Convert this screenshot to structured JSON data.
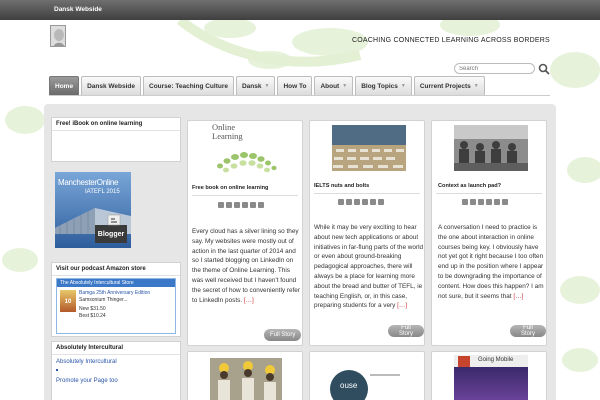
{
  "site": {
    "top_link": "Dansk Webside",
    "tagline": "COACHING CONNECTED LEARNING ACROSS BORDERS",
    "search_placeholder": "Search"
  },
  "nav": {
    "tabs": [
      {
        "label": "Home",
        "active": true,
        "has_sub": false
      },
      {
        "label": "Dansk Webside",
        "active": false,
        "has_sub": false
      },
      {
        "label": "Course: Teaching Culture",
        "active": false,
        "has_sub": false
      },
      {
        "label": "Dansk",
        "active": false,
        "has_sub": true
      },
      {
        "label": "How To",
        "active": false,
        "has_sub": false
      },
      {
        "label": "About",
        "active": false,
        "has_sub": true
      },
      {
        "label": "Blog Topics",
        "active": false,
        "has_sub": true
      },
      {
        "label": "Current Projects",
        "active": false,
        "has_sub": true
      }
    ]
  },
  "sidebar": {
    "ibook_title": "Free! iBook on online learning",
    "badge": {
      "line1": "ManchesterOnline",
      "line2": "IATEFL 2015",
      "label": "Blogger"
    },
    "amazon_title": "Visit our podcast Amazon store",
    "amazon": {
      "header": "The Absolutely Intercultural Store",
      "product_title": "Bamga 25th Anniversary Edition",
      "product_sub": "Samsonium Thinger...",
      "new_price": "New $31.50",
      "best_price": "Best $10.24"
    },
    "ai_title": "Absolutely Intercultural",
    "ai_links": [
      "Absolutely Intercultural",
      "Promote your Page too"
    ]
  },
  "posts": [
    {
      "title": "Free book on online learning",
      "thumb_text": [
        "Online",
        "Learning"
      ],
      "excerpt": "Every cloud has a silver lining so they say. My websites were mostly out of action in the last quarter of 2014 and so I started blogging on LinkedIn on the theme of Online Learning. This was well received but I haven't found the secret of how to conveniently refer to LinkedIn posts.",
      "more": "[…]",
      "button": "Full Story"
    },
    {
      "title": "IELTS nuts and bolts",
      "excerpt": "While it may be very exciting to hear about new tech applications or about initiatives in far-flung parts of the world or even about ground-breaking pedagogical approaches, there will always be a place for learning more about the bread and butter of TEFL, ie teaching English, or, in this case, preparing students for a very",
      "more": "[…]",
      "button": "Full Story"
    },
    {
      "title": "Context as launch pad?",
      "excerpt": "A conversation I need to practice is the one about interaction in online courses being key. I obviously have not yet got it right because I too often end up in the position where I appear to be downgrading the importance of content. How does this happen? I am not sure, but it seems that",
      "more": "[…]",
      "button": "Full Story"
    }
  ],
  "bottom_cards": {
    "house_label": "ouse",
    "mobile_label": "Going Mobile"
  },
  "colors": {
    "nav_active": "#7d7d7d",
    "link": "#2a56a8",
    "more": "#cc3333",
    "bubble_green": "#cfe6b8"
  }
}
